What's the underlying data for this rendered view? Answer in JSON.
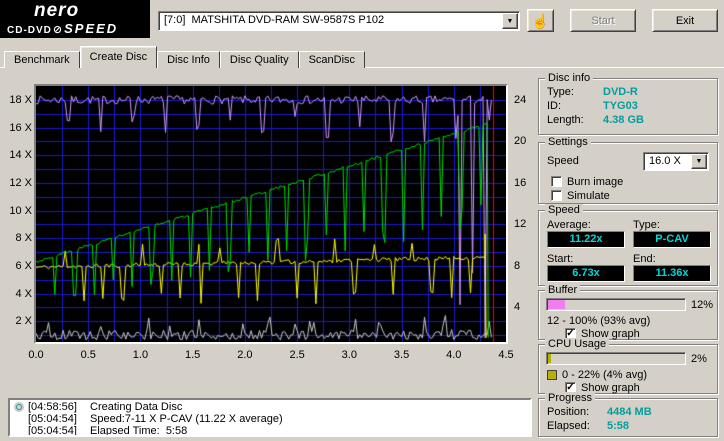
{
  "header": {
    "logo_brand": "nero",
    "logo_product_cd": "CD-DVD",
    "logo_product_speed": "SPEED",
    "drive": "[7:0]  MATSHITA DVD-RAM SW-9587S P102",
    "start_label": "Start",
    "exit_label": "Exit"
  },
  "icons": {
    "dropdown_arrow": "▼",
    "check": "✓",
    "hand": "☝",
    "logo_disc": "⊘"
  },
  "tabs": [
    {
      "label": "Benchmark",
      "active": false
    },
    {
      "label": "Create Disc",
      "active": true
    },
    {
      "label": "Disc Info",
      "active": false
    },
    {
      "label": "Disc Quality",
      "active": false
    },
    {
      "label": "ScanDisc",
      "active": false
    }
  ],
  "chart_data": {
    "type": "line",
    "x_axis": {
      "range": [
        0,
        4.5
      ],
      "ticks": [
        "0.0",
        "0.5",
        "1.0",
        "1.5",
        "2.0",
        "2.5",
        "3.0",
        "3.5",
        "4.0",
        "4.5"
      ],
      "unit": "GB"
    },
    "y_left_axis": {
      "range": [
        0.5,
        19
      ],
      "ticks": [
        2,
        4,
        6,
        8,
        10,
        12,
        14,
        16,
        18
      ],
      "suffix": " X"
    },
    "y_right_axis": {
      "ticks": [
        4,
        8,
        12,
        16,
        20,
        24
      ],
      "left_equivalent_factor": 0.75
    },
    "grid": {
      "color": "#1a1ad0",
      "x_step": 0.25,
      "y_step": 1
    },
    "plot_bg": "#000000",
    "cursor": {
      "x": 4.38,
      "color": "#ff0000"
    },
    "series": [
      {
        "name": "cpu-usage-line",
        "color": "#c8c8c8",
        "kind": "noise",
        "base": 1.0,
        "jitter": 0.35,
        "spike_chance": 0.08,
        "spike_mag": 0.9,
        "x_end": 4.36,
        "seed": 5
      },
      {
        "name": "pc-buffer-line",
        "color": "#cc99ff",
        "kind": "flat_dips",
        "base": 18.0,
        "jitter": 0.3,
        "dip_period": 0.31,
        "dip_depth": [
          0.8,
          3.2
        ],
        "deep_drops": [
          {
            "x": 4.06,
            "to": 3.2
          },
          {
            "x": 4.18,
            "to": 5.5
          },
          {
            "x": 4.3,
            "to": 0.8
          }
        ],
        "x_end": 4.36,
        "seed": 7
      },
      {
        "name": "drive-buffer-line",
        "color": "#ffff00",
        "kind": "ramp_dips",
        "start": 5.9,
        "end": 6.6,
        "jitter": 0.15,
        "dip_period": 0.185,
        "dip_phase": 0.09,
        "dip_depth_start": 2.6,
        "dip_depth_end": 3.4,
        "up_chance": 0.22,
        "up_mag": 1.7,
        "x_end": 4.3,
        "final_points": [
          [
            4.3,
            8.3
          ],
          [
            4.31,
            0.8
          ]
        ],
        "seed": 11
      },
      {
        "name": "write-speed-line",
        "color": "#00dd00",
        "kind": "ramp_dips",
        "start": 6.3,
        "end": 16.3,
        "jitter": 0.1,
        "dip_period": 0.185,
        "dip_phase": 0,
        "dip_depth_start": 3.5,
        "dip_depth_end": 7.5,
        "up_chance": 0,
        "up_mag": 0,
        "x_end": 4.33,
        "final_points": [
          [
            4.33,
            0.8
          ]
        ],
        "seed": 3
      }
    ],
    "summary": {
      "start_speed_x": 6.73,
      "end_speed_x": 11.36,
      "average_speed_x": 11.22,
      "write_type": "P-CAV"
    }
  },
  "panels": {
    "disc_info": {
      "title": "Disc info",
      "rows": [
        {
          "label": "Type:",
          "value": "DVD-R"
        },
        {
          "label": "ID:",
          "value": "TYG03"
        },
        {
          "label": "Length:",
          "value": "4.38 GB"
        }
      ]
    },
    "settings": {
      "title": "Settings",
      "speed_label": "Speed",
      "speed_value": "16.0 X",
      "checkboxes": [
        {
          "label": "Burn image",
          "checked": false
        },
        {
          "label": "Simulate",
          "checked": false
        }
      ]
    },
    "speed": {
      "title": "Speed",
      "average_label": "Average:",
      "average_value": "11.22x",
      "type_label": "Type:",
      "type_value": "P-CAV",
      "start_label": "Start:",
      "start_value": "6.73x",
      "end_label": "End:",
      "end_value": "11.36x"
    },
    "buffer": {
      "title": "Buffer",
      "bar_percent": 12,
      "bar_color": "#f07ef0",
      "bar_label": "12%",
      "range_text": "12 - 100% (93% avg)",
      "show_graph_label": "Show graph",
      "show_graph_checked": true
    },
    "cpu": {
      "title": "CPU Usage",
      "bar_percent": 2,
      "bar_color": "#b8b000",
      "swatch_color": "#b8b000",
      "bar_label": "2%",
      "range_text": "0 - 22% (4% avg)",
      "show_graph_label": "Show graph",
      "show_graph_checked": true
    },
    "progress": {
      "title": "Progress",
      "position_label": "Position:",
      "position_value": "4484 MB",
      "elapsed_label": "Elapsed:",
      "elapsed_value": "5:58"
    }
  },
  "log": {
    "lines": [
      {
        "time": "[04:58:56]",
        "text": "Creating Data Disc",
        "icon": "disc"
      },
      {
        "time": "[05:04:54]",
        "text": "Speed:7-11 X P-CAV (11.22 X average)"
      },
      {
        "time": "[05:04:54]",
        "text": "Elapsed Time:  5:58"
      }
    ]
  }
}
